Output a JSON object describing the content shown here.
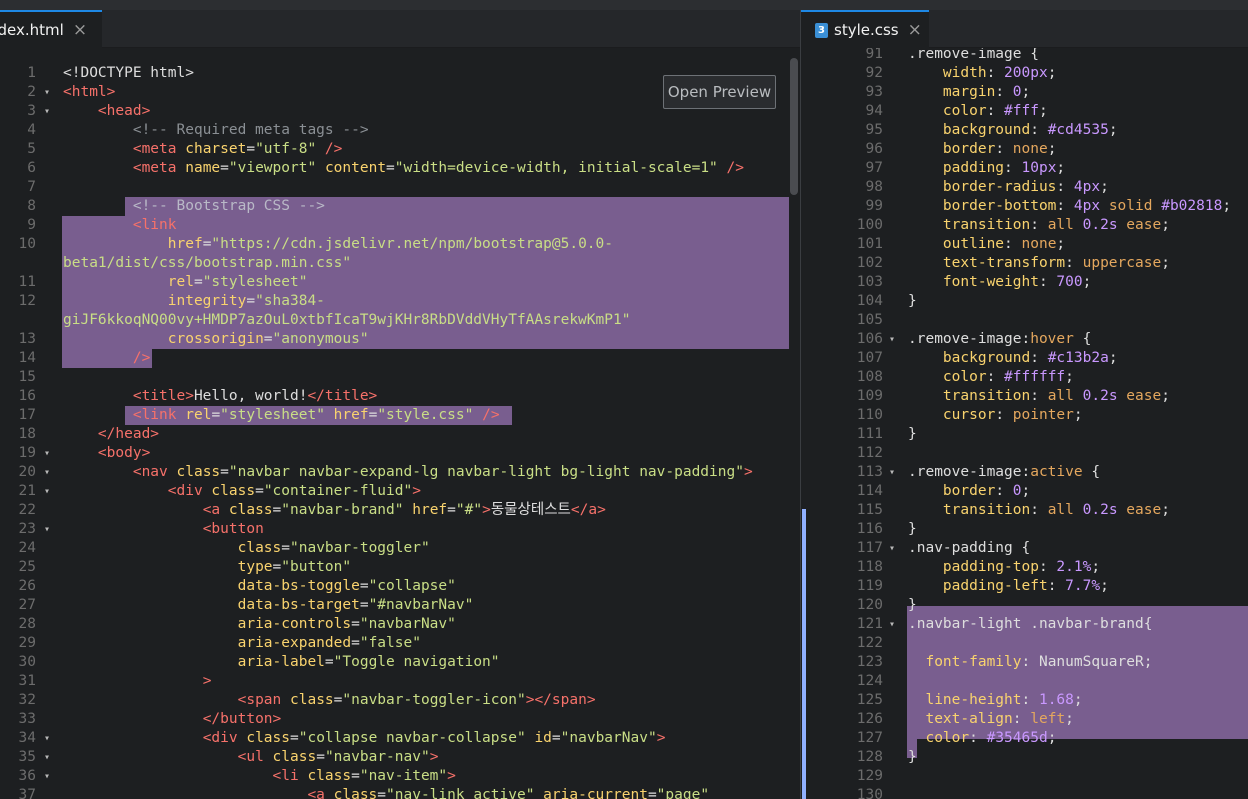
{
  "left_tab": {
    "name": "ndex.html",
    "close": "×"
  },
  "right_tab": {
    "name": "style.css",
    "close": "×",
    "icon": "3"
  },
  "preview_button": "Open Preview",
  "left_lines": [
    {
      "n": "1",
      "f": "",
      "html": "<span class=\"e\">&lt;!DOCTYPE html&gt;</span>"
    },
    {
      "n": "2",
      "f": "▾",
      "html": "<span class=\"t\">&lt;html&gt;</span>"
    },
    {
      "n": "3",
      "f": "▾",
      "html": "    <span class=\"t\">&lt;head&gt;</span>"
    },
    {
      "n": "4",
      "f": "",
      "html": "        <span class=\"c\">&lt;!-- Required meta tags --&gt;</span>"
    },
    {
      "n": "5",
      "f": "",
      "html": "        <span class=\"t\">&lt;meta</span> <span class=\"a\">charset</span>=<span class=\"s\">\"utf-8\"</span> <span class=\"t\">/&gt;</span>"
    },
    {
      "n": "6",
      "f": "",
      "html": "        <span class=\"t\">&lt;meta</span> <span class=\"a\">name</span>=<span class=\"s\">\"viewport\"</span> <span class=\"a\">content</span>=<span class=\"s\">\"width=device-width, initial-scale=1\"</span> <span class=\"t\">/&gt;</span>"
    },
    {
      "n": "7",
      "f": "",
      "html": ""
    },
    {
      "n": "8",
      "f": "",
      "html": "        <span class=\"c in-hl\">&lt;!-- Bootstrap CSS --&gt;</span>"
    },
    {
      "n": "9",
      "f": "",
      "html": "        <span class=\"t\">&lt;link</span>"
    },
    {
      "n": "10",
      "f": "",
      "html": "            <span class=\"a\">href</span>=<span class=\"s\">\"https://cdn.jsdelivr.net/npm/bootstrap@5.0.0-</span>"
    },
    {
      "n": "",
      "f": "",
      "html": "<span class=\"s\">beta1/dist/css/bootstrap.min.css\"</span>"
    },
    {
      "n": "11",
      "f": "",
      "html": "            <span class=\"a\">rel</span>=<span class=\"s\">\"stylesheet\"</span>"
    },
    {
      "n": "12",
      "f": "",
      "html": "            <span class=\"a\">integrity</span>=<span class=\"s\">\"sha384-</span>"
    },
    {
      "n": "",
      "f": "",
      "html": "<span class=\"s\">giJF6kkoqNQ00vy+HMDP7azOuL0xtbfIcaT9wjKHr8RbDVddVHyTfAAsrekwKmP1\"</span>"
    },
    {
      "n": "13",
      "f": "",
      "html": "            <span class=\"a\">crossorigin</span>=<span class=\"s\">\"anonymous\"</span>"
    },
    {
      "n": "14",
      "f": "",
      "html": "        <span class=\"t\">/&gt;</span>"
    },
    {
      "n": "15",
      "f": "",
      "html": ""
    },
    {
      "n": "16",
      "f": "",
      "html": "        <span class=\"t\">&lt;title&gt;</span><span class=\"e\">Hello, world!</span><span class=\"t\">&lt;/title&gt;</span>"
    },
    {
      "n": "17",
      "f": "",
      "html": "        <span class=\"t\">&lt;link</span> <span class=\"a\">rel</span>=<span class=\"s\">\"stylesheet\"</span> <span class=\"a\">href</span>=<span class=\"s\">\"style.css\"</span> <span class=\"t\">/&gt;</span>"
    },
    {
      "n": "18",
      "f": "",
      "html": "    <span class=\"t\">&lt;/head&gt;</span>"
    },
    {
      "n": "19",
      "f": "▾",
      "html": "    <span class=\"t\">&lt;body&gt;</span>"
    },
    {
      "n": "20",
      "f": "▾",
      "html": "        <span class=\"t\">&lt;nav</span> <span class=\"a\">class</span>=<span class=\"s\">\"navbar navbar-expand-lg navbar-light bg-light nav-padding\"</span><span class=\"t\">&gt;</span>"
    },
    {
      "n": "21",
      "f": "▾",
      "html": "            <span class=\"t\">&lt;div</span> <span class=\"a\">class</span>=<span class=\"s\">\"container-fluid\"</span><span class=\"t\">&gt;</span>"
    },
    {
      "n": "22",
      "f": "",
      "html": "                <span class=\"t\">&lt;a</span> <span class=\"a\">class</span>=<span class=\"s\">\"navbar-brand\"</span> <span class=\"a\">href</span>=<span class=\"s\">\"#\"</span><span class=\"t\">&gt;</span><span class=\"e\">동물상테스트</span><span class=\"t\">&lt;/a&gt;</span>"
    },
    {
      "n": "23",
      "f": "▾",
      "html": "                <span class=\"t\">&lt;button</span>"
    },
    {
      "n": "24",
      "f": "",
      "html": "                    <span class=\"a\">class</span>=<span class=\"s\">\"navbar-toggler\"</span>"
    },
    {
      "n": "25",
      "f": "",
      "html": "                    <span class=\"a\">type</span>=<span class=\"s\">\"button\"</span>"
    },
    {
      "n": "26",
      "f": "",
      "html": "                    <span class=\"a\">data-bs-toggle</span>=<span class=\"s\">\"collapse\"</span>"
    },
    {
      "n": "27",
      "f": "",
      "html": "                    <span class=\"a\">data-bs-target</span>=<span class=\"s\">\"#navbarNav\"</span>"
    },
    {
      "n": "28",
      "f": "",
      "html": "                    <span class=\"a\">aria-controls</span>=<span class=\"s\">\"navbarNav\"</span>"
    },
    {
      "n": "29",
      "f": "",
      "html": "                    <span class=\"a\">aria-expanded</span>=<span class=\"s\">\"false\"</span>"
    },
    {
      "n": "30",
      "f": "",
      "html": "                    <span class=\"a\">aria-label</span>=<span class=\"s\">\"Toggle navigation\"</span>"
    },
    {
      "n": "31",
      "f": "",
      "html": "                <span class=\"t\">&gt;</span>"
    },
    {
      "n": "32",
      "f": "",
      "html": "                    <span class=\"t\">&lt;span</span> <span class=\"a\">class</span>=<span class=\"s\">\"navbar-toggler-icon\"</span><span class=\"t\">&gt;&lt;/span&gt;</span>"
    },
    {
      "n": "33",
      "f": "",
      "html": "                <span class=\"t\">&lt;/button&gt;</span>"
    },
    {
      "n": "34",
      "f": "▾",
      "html": "                <span class=\"t\">&lt;div</span> <span class=\"a\">class</span>=<span class=\"s\">\"collapse navbar-collapse\"</span> <span class=\"a\">id</span>=<span class=\"s\">\"navbarNav\"</span><span class=\"t\">&gt;</span>"
    },
    {
      "n": "35",
      "f": "▾",
      "html": "                    <span class=\"t\">&lt;ul</span> <span class=\"a\">class</span>=<span class=\"s\">\"navbar-nav\"</span><span class=\"t\">&gt;</span>"
    },
    {
      "n": "36",
      "f": "▾",
      "html": "                        <span class=\"t\">&lt;li</span> <span class=\"a\">class</span>=<span class=\"s\">\"nav-item\"</span><span class=\"t\">&gt;</span>"
    },
    {
      "n": "37",
      "f": "",
      "html": "                            <span class=\"t\">&lt;a</span> <span class=\"a\">class</span>=<span class=\"s\">\"nav-link active\"</span> <span class=\"a\">aria-current</span>=<span class=\"s\">\"page\"</span>"
    }
  ],
  "right_lines": [
    {
      "n": "91",
      "f": "",
      "html": "<span class=\"e\">.remove-image {</span>"
    },
    {
      "n": "92",
      "f": "",
      "html": "    <span class=\"p\">width</span>: <span class=\"n\">200px</span>;"
    },
    {
      "n": "93",
      "f": "",
      "html": "    <span class=\"p\">margin</span>: <span class=\"n\">0</span>;"
    },
    {
      "n": "94",
      "f": "",
      "html": "    <span class=\"p\">color</span>: <span class=\"n\">#fff</span>;"
    },
    {
      "n": "95",
      "f": "",
      "html": "    <span class=\"p\">background</span>: <span class=\"n\">#cd4535</span>;"
    },
    {
      "n": "96",
      "f": "",
      "html": "    <span class=\"p\">border</span>: <span class=\"k\">none</span>;"
    },
    {
      "n": "97",
      "f": "",
      "html": "    <span class=\"p\">padding</span>: <span class=\"n\">10px</span>;"
    },
    {
      "n": "98",
      "f": "",
      "html": "    <span class=\"p\">border-radius</span>: <span class=\"n\">4px</span>;"
    },
    {
      "n": "99",
      "f": "",
      "html": "    <span class=\"p\">border-bottom</span>: <span class=\"n\">4px</span> <span class=\"k\">solid</span> <span class=\"n\">#b02818</span>;"
    },
    {
      "n": "100",
      "f": "",
      "html": "    <span class=\"p\">transition</span>: <span class=\"k\">all</span> <span class=\"n\">0.2s</span> <span class=\"k\">ease</span>;"
    },
    {
      "n": "101",
      "f": "",
      "html": "    <span class=\"p\">outline</span>: <span class=\"k\">none</span>;"
    },
    {
      "n": "102",
      "f": "",
      "html": "    <span class=\"p\">text-transform</span>: <span class=\"k\">uppercase</span>;"
    },
    {
      "n": "103",
      "f": "",
      "html": "    <span class=\"p\">font-weight</span>: <span class=\"n\">700</span>;"
    },
    {
      "n": "104",
      "f": "",
      "html": "<span class=\"e\">}</span>"
    },
    {
      "n": "105",
      "f": "",
      "html": ""
    },
    {
      "n": "106",
      "f": "▾",
      "html": "<span class=\"e\">.remove-image:</span><span class=\"k\">hover</span> <span class=\"e\">{</span>"
    },
    {
      "n": "107",
      "f": "",
      "html": "    <span class=\"p\">background</span>: <span class=\"n\">#c13b2a</span>;"
    },
    {
      "n": "108",
      "f": "",
      "html": "    <span class=\"p\">color</span>: <span class=\"n\">#ffffff</span>;"
    },
    {
      "n": "109",
      "f": "",
      "html": "    <span class=\"p\">transition</span>: <span class=\"k\">all</span> <span class=\"n\">0.2s</span> <span class=\"k\">ease</span>;"
    },
    {
      "n": "110",
      "f": "",
      "html": "    <span class=\"p\">cursor</span>: <span class=\"k\">pointer</span>;"
    },
    {
      "n": "111",
      "f": "",
      "html": "<span class=\"e\">}</span>"
    },
    {
      "n": "112",
      "f": "",
      "html": ""
    },
    {
      "n": "113",
      "f": "▾",
      "html": "<span class=\"e\">.remove-image:</span><span class=\"k\">active</span> <span class=\"e\">{</span>"
    },
    {
      "n": "114",
      "f": "",
      "html": "    <span class=\"p\">border</span>: <span class=\"n\">0</span>;"
    },
    {
      "n": "115",
      "f": "",
      "html": "    <span class=\"p\">transition</span>: <span class=\"k\">all</span> <span class=\"n\">0.2s</span> <span class=\"k\">ease</span>;"
    },
    {
      "n": "116",
      "f": "",
      "html": "<span class=\"e\">}</span>"
    },
    {
      "n": "117",
      "f": "▾",
      "html": "<span class=\"e\">.nav-padding {</span>"
    },
    {
      "n": "118",
      "f": "",
      "html": "    <span class=\"p\">padding-top</span>: <span class=\"n\">2.1%</span>;"
    },
    {
      "n": "119",
      "f": "",
      "html": "    <span class=\"p\">padding-left</span>: <span class=\"n\">7.7%</span>;"
    },
    {
      "n": "120",
      "f": "",
      "html": "<span class=\"e\">}</span>"
    },
    {
      "n": "121",
      "f": "▾",
      "html": "<span class=\"e\">.navbar-light .navbar-brand{</span>"
    },
    {
      "n": "122",
      "f": "",
      "html": ""
    },
    {
      "n": "123",
      "f": "",
      "html": "  <span class=\"p\">font-family</span>: <span class=\"e\">NanumSquareR</span>;"
    },
    {
      "n": "124",
      "f": "",
      "html": ""
    },
    {
      "n": "125",
      "f": "",
      "html": "  <span class=\"p\">line-height</span>: <span class=\"n\">1.68</span>;"
    },
    {
      "n": "126",
      "f": "",
      "html": "  <span class=\"p\">text-align</span>: <span class=\"k\">left</span>;"
    },
    {
      "n": "127",
      "f": "",
      "html": "  <span class=\"p\">color</span>: <span class=\"n\">#35465d</span>;"
    },
    {
      "n": "128",
      "f": "",
      "html": "<span class=\"e\">}</span>"
    },
    {
      "n": "129",
      "f": "",
      "html": ""
    },
    {
      "n": "130",
      "f": "",
      "html": ""
    }
  ]
}
